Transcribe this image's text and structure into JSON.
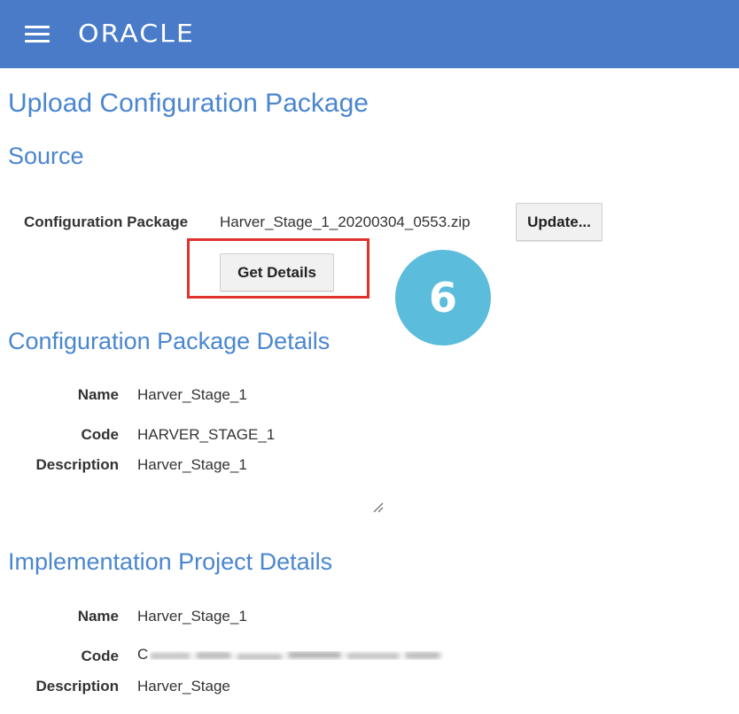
{
  "header": {
    "brand": "ORACLE",
    "menu_icon": "hamburger-menu-icon",
    "colors": {
      "bar": "#4a7bc9",
      "text": "#ffffff"
    }
  },
  "page": {
    "title": "Upload Configuration Package"
  },
  "source": {
    "heading": "Source",
    "package_label": "Configuration Package",
    "package_file": "Harver_Stage_1_20200304_0553.zip",
    "update_button": "Update...",
    "get_details_button": "Get Details"
  },
  "annotation": {
    "step_number": "6",
    "badge_color": "#5bbcdc",
    "highlight_color": "#e0312d"
  },
  "package_details": {
    "heading": "Configuration Package Details",
    "name_label": "Name",
    "name_value": "Harver_Stage_1",
    "code_label": "Code",
    "code_value": "HARVER_STAGE_1",
    "description_label": "Description",
    "description_value": "Harver_Stage_1"
  },
  "project_details": {
    "heading": "Implementation Project Details",
    "name_label": "Name",
    "name_value": "Harver_Stage_1",
    "code_label": "Code",
    "code_value": "C",
    "description_label": "Description",
    "description_value": "Harver_Stage"
  },
  "heading_color": "#4a86cf"
}
